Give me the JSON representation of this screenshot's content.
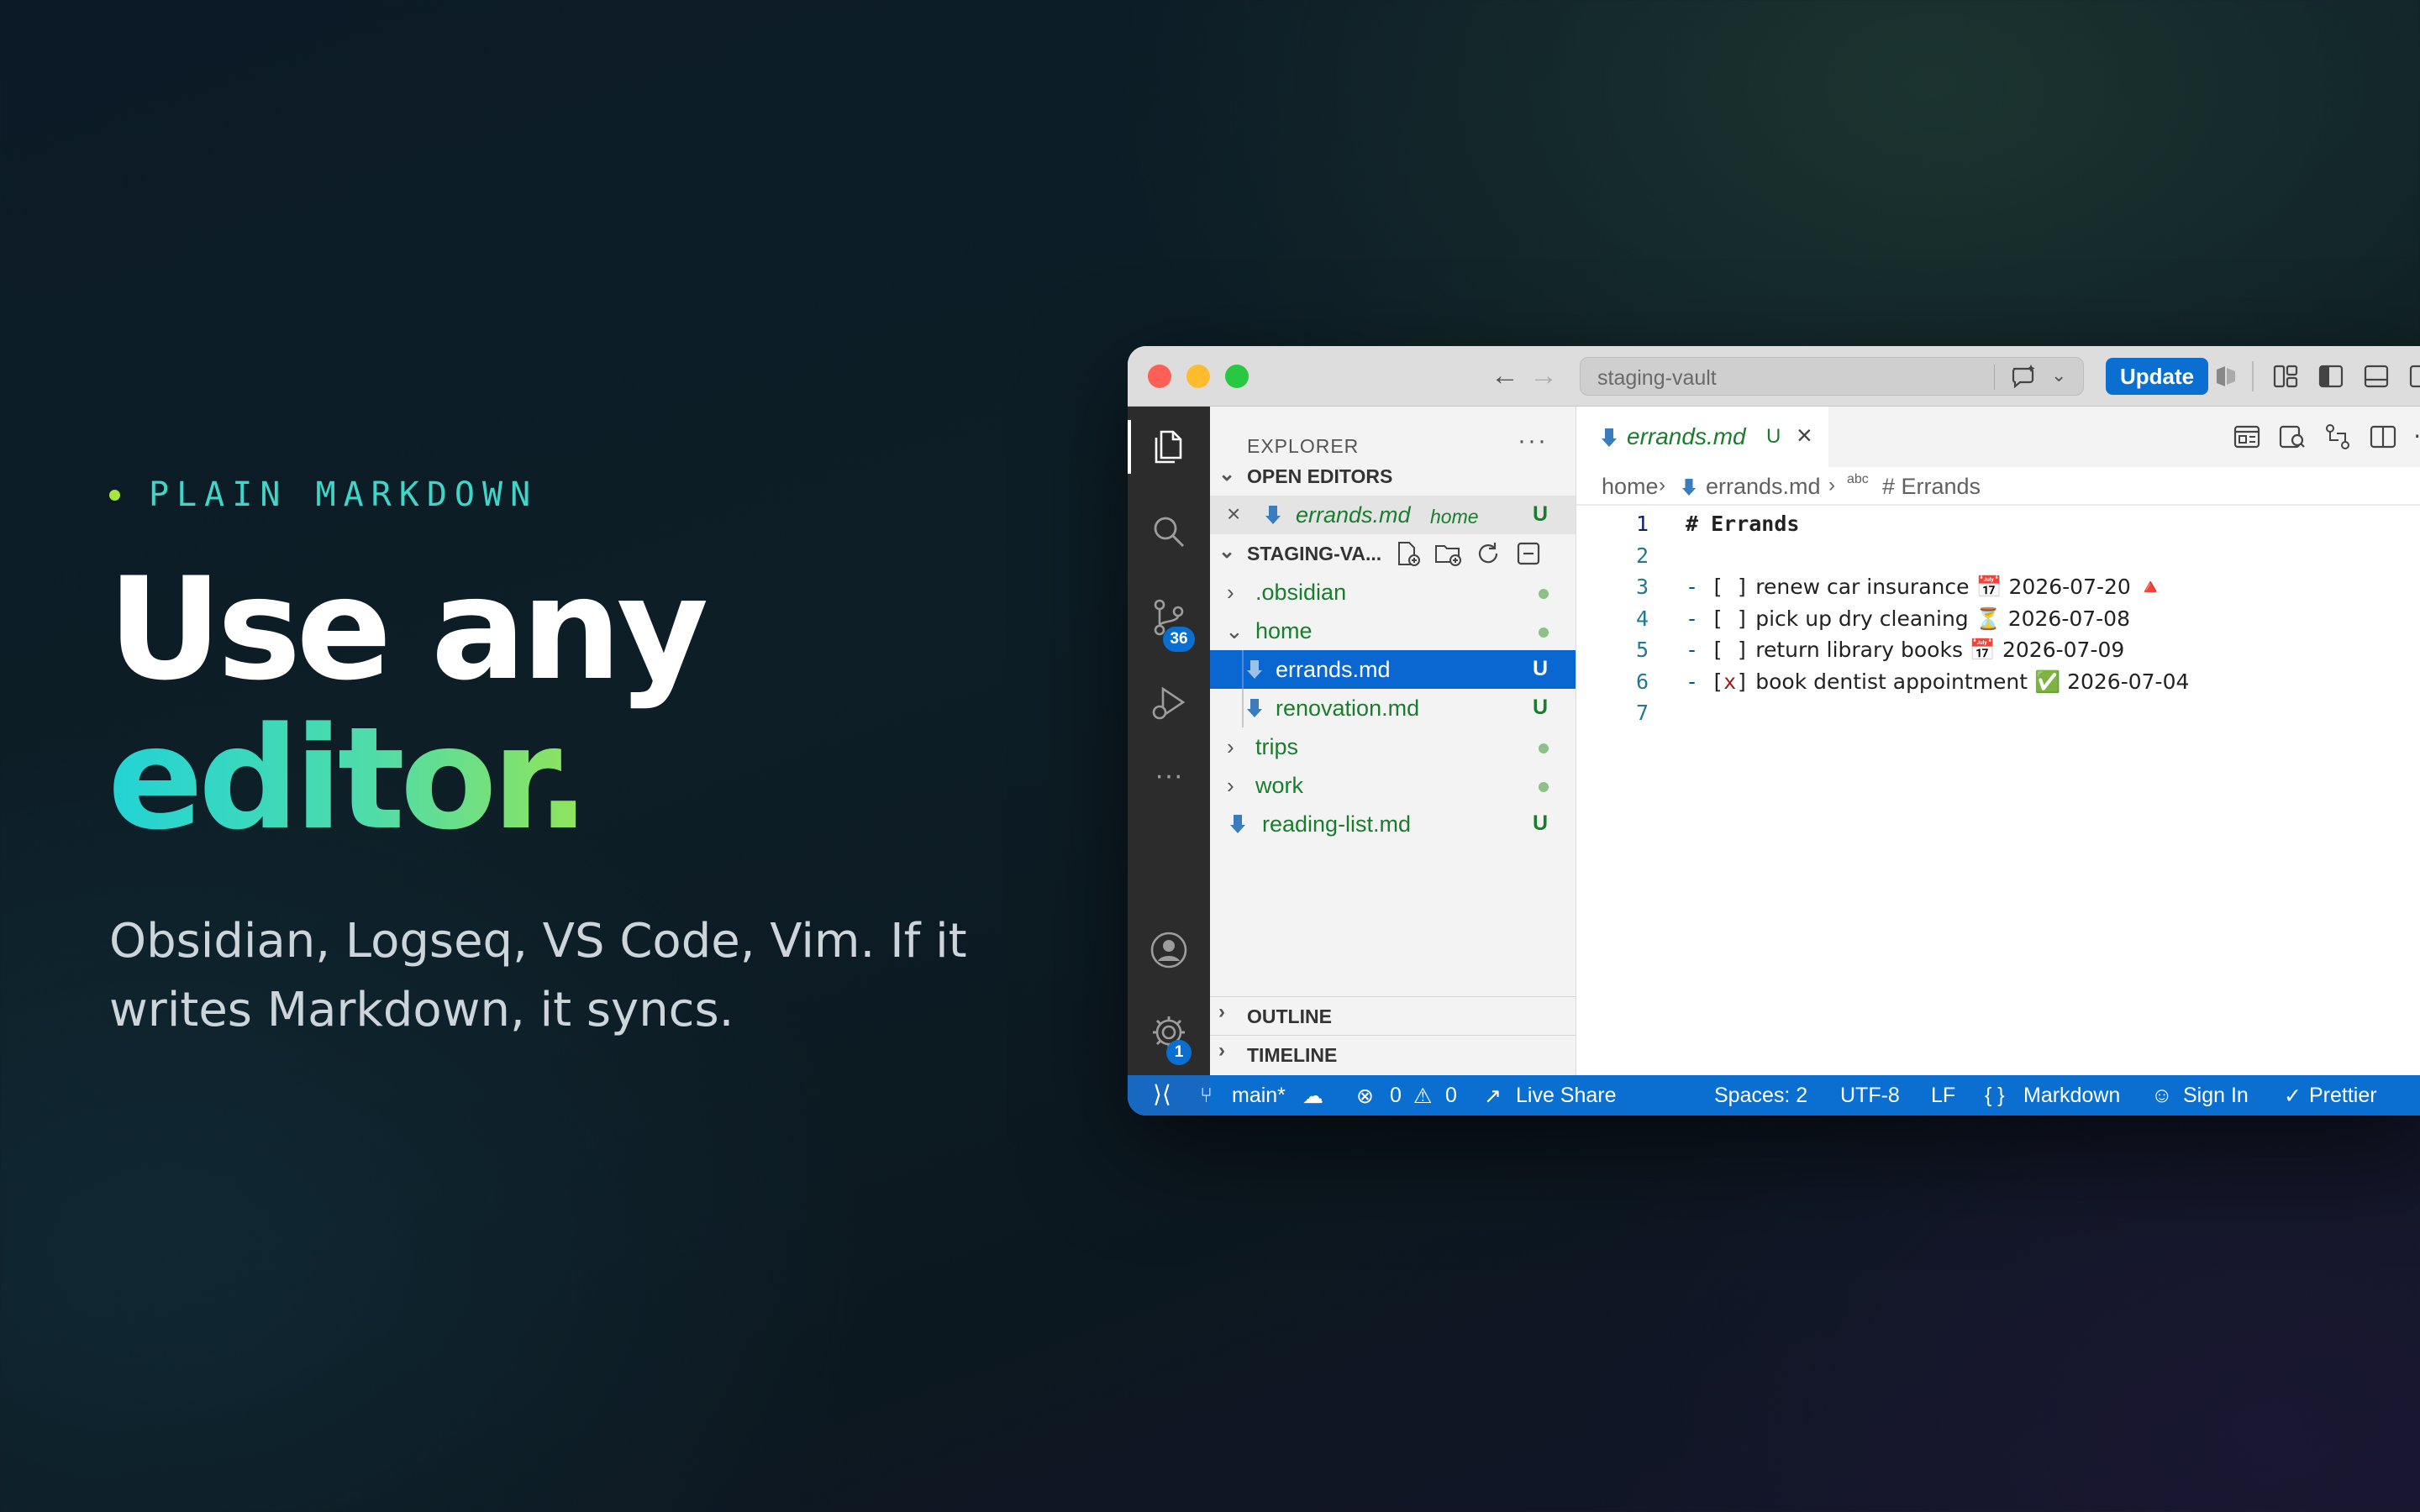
{
  "hero": {
    "eyebrow": "PLAIN MARKDOWN",
    "headline_line1": "Use any",
    "headline_line2": "editor.",
    "subtitle": "Obsidian, Logseq, VS Code, Vim. If it writes Markdown, it syncs."
  },
  "window": {
    "command_center_placeholder": "staging-vault",
    "update_button": "Update"
  },
  "activity_bar": {
    "items": [
      "files-icon",
      "search-icon",
      "source-control-icon",
      "run-debug-icon",
      "more-icon",
      "account-icon",
      "settings-icon"
    ],
    "source_control_badge": "36",
    "settings_badge": "1"
  },
  "explorer": {
    "title": "EXPLORER",
    "more": "···",
    "open_editors_header": "OPEN EDITORS",
    "open_editor": {
      "name": "errands.md",
      "folder": "home",
      "status": "U"
    },
    "workspace_header": "STAGING-VA...",
    "tree": [
      {
        "name": ".obsidian",
        "type": "folder",
        "expanded": false,
        "status": "dot"
      },
      {
        "name": "home",
        "type": "folder",
        "expanded": true,
        "status": "dot"
      },
      {
        "name": "errands.md",
        "type": "file",
        "status": "U",
        "selected": true
      },
      {
        "name": "renovation.md",
        "type": "file",
        "status": "U"
      },
      {
        "name": "trips",
        "type": "folder",
        "expanded": false,
        "status": "dot"
      },
      {
        "name": "work",
        "type": "folder",
        "expanded": false,
        "status": "dot"
      },
      {
        "name": "reading-list.md",
        "type": "file",
        "status": "U"
      }
    ],
    "outline_header": "OUTLINE",
    "timeline_header": "TIMELINE"
  },
  "editor": {
    "tab": {
      "name": "errands.md",
      "status": "U"
    },
    "breadcrumbs": [
      "home",
      "errands.md",
      "# Errands"
    ],
    "breadcrumb_symbol_prefix": "abc",
    "lines": [
      {
        "n": "1",
        "text": "# Errands"
      },
      {
        "n": "2",
        "text": ""
      },
      {
        "n": "3",
        "text": "- [ ] renew car insurance 📅 2026-07-20 🔺"
      },
      {
        "n": "4",
        "text": "- [ ] pick up dry cleaning ⏳ 2026-07-08"
      },
      {
        "n": "5",
        "text": "- [ ] return library books 📅 2026-07-09"
      },
      {
        "n": "6",
        "text": "- [x] book dentist appointment ✅ 2026-07-04"
      },
      {
        "n": "7",
        "text": ""
      }
    ]
  },
  "statusbar": {
    "branch": "main*",
    "errors": "0",
    "warnings": "0",
    "live_share": "Live Share",
    "spaces": "Spaces: 2",
    "encoding": "UTF-8",
    "eol": "LF",
    "language": "Markdown",
    "sign_in": "Sign In",
    "prettier": "Prettier"
  },
  "colors": {
    "accent_blue": "#0a6fd1",
    "git_untracked_green": "#1a7d2e",
    "eyebrow_teal": "#3dd6c8",
    "eyebrow_dot": "#a8e63c"
  }
}
